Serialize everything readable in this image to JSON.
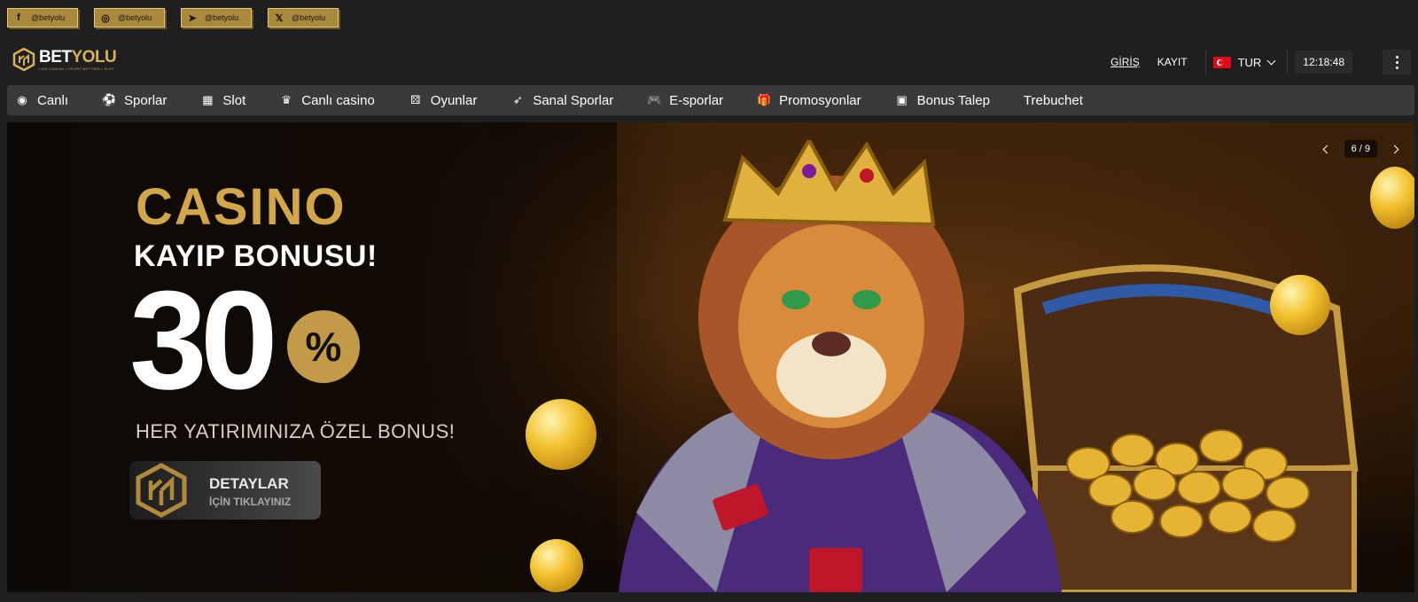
{
  "social": [
    {
      "icon": "facebook-icon",
      "glyph": "f",
      "label": "@betyolu"
    },
    {
      "icon": "instagram-icon",
      "glyph": "◎",
      "label": "@betyolu"
    },
    {
      "icon": "telegram-icon",
      "glyph": "➤",
      "label": "@betyolu"
    },
    {
      "icon": "x-icon",
      "glyph": "𝕏",
      "label": "@betyolu"
    }
  ],
  "header": {
    "logo_bet": "BET",
    "logo_yolu": "YOLU",
    "logo_sub": "LIVE CASINO • SPORT BETTING • SLOT",
    "login": "GİRİŞ",
    "register": "KAYIT",
    "language": "TUR",
    "time": "12:18:48"
  },
  "nav": [
    {
      "icon": "live-icon",
      "glyph": "◉",
      "label": "Canlı"
    },
    {
      "icon": "soccer-ball-icon",
      "glyph": "⚽",
      "label": "Sporlar"
    },
    {
      "icon": "slot-icon",
      "glyph": "▦",
      "label": "Slot"
    },
    {
      "icon": "dealer-icon",
      "glyph": "♛",
      "label": "Canlı casino"
    },
    {
      "icon": "dice-icon",
      "glyph": "⚄",
      "label": "Oyunlar"
    },
    {
      "icon": "virtual-sports-icon",
      "glyph": "➶",
      "label": "Sanal Sporlar"
    },
    {
      "icon": "gamepad-icon",
      "glyph": "🎮",
      "label": "E-sporlar"
    },
    {
      "icon": "gift-icon",
      "glyph": "🎁",
      "label": "Promosyonlar"
    },
    {
      "icon": "bonus-icon",
      "glyph": "▣",
      "label": "Bonus Talep"
    },
    {
      "icon": "",
      "glyph": "",
      "label": "Trebuchet"
    }
  ],
  "banner": {
    "title": "CASINO",
    "subtitle": "KAYIP BONUSU!",
    "number": "30",
    "percent": "%",
    "tagline": "HER YATIRIMINIZA ÖZEL BONUS!",
    "cta_line1": "DETAYLAR",
    "cta_line2": "İÇİN TIKLAYINIZ",
    "slide_counter": "6 / 9"
  },
  "colors": {
    "accent_gold": "#c39a47",
    "nav_bg": "#3a3a3a",
    "page_bg": "#1f1f1f"
  }
}
